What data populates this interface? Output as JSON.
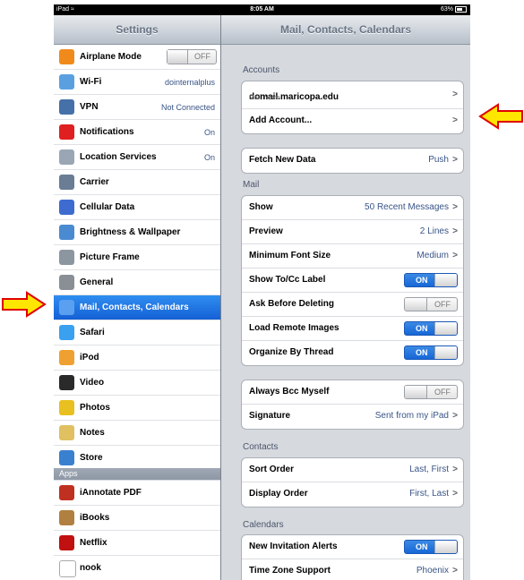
{
  "statusbar": {
    "device": "iPad",
    "time": "8:05 AM",
    "battery": "63%"
  },
  "left": {
    "title": "Settings",
    "items": [
      {
        "label": "Airplane Mode",
        "toggle": "OFF",
        "icon": "airplane-icon",
        "color": "#f08a1a"
      },
      {
        "label": "Wi-Fi",
        "value": "dointernalplus",
        "icon": "wifi-icon",
        "color": "#5aa0e0"
      },
      {
        "label": "VPN",
        "value": "Not Connected",
        "icon": "vpn-icon",
        "color": "#4670a8"
      },
      {
        "label": "Notifications",
        "value": "On",
        "icon": "notifications-icon",
        "color": "#e02020"
      },
      {
        "label": "Location Services",
        "value": "On",
        "icon": "location-icon",
        "color": "#9aa6b4"
      },
      {
        "label": "Carrier",
        "icon": "carrier-icon",
        "color": "#6a7d95"
      },
      {
        "label": "Cellular Data",
        "icon": "cellular-icon",
        "color": "#3d6bd0"
      },
      {
        "label": "Brightness & Wallpaper",
        "icon": "brightness-icon",
        "color": "#4a8ad0"
      },
      {
        "label": "Picture Frame",
        "icon": "picture-frame-icon",
        "color": "#8c96a0"
      },
      {
        "label": "General",
        "icon": "gear-icon",
        "color": "#8a8f96"
      },
      {
        "label": "Mail, Contacts, Calendars",
        "icon": "mail-icon",
        "color": "#5aa0f0",
        "selected": true
      },
      {
        "label": "Safari",
        "icon": "safari-icon",
        "color": "#3aa0f0"
      },
      {
        "label": "iPod",
        "icon": "ipod-icon",
        "color": "#f0a030"
      },
      {
        "label": "Video",
        "icon": "video-icon",
        "color": "#2a2a2a"
      },
      {
        "label": "Photos",
        "icon": "photos-icon",
        "color": "#e8c020"
      },
      {
        "label": "Notes",
        "icon": "notes-icon",
        "color": "#e0c060"
      },
      {
        "label": "Store",
        "icon": "store-icon",
        "color": "#3a80d0"
      }
    ],
    "apps_header": "Apps",
    "apps": [
      {
        "label": "iAnnotate PDF",
        "icon": "iannotate-icon",
        "color": "#c03020"
      },
      {
        "label": "iBooks",
        "icon": "ibooks-icon",
        "color": "#b08040"
      },
      {
        "label": "Netflix",
        "icon": "netflix-icon",
        "color": "#c01010"
      },
      {
        "label": "nook",
        "icon": "nook-icon",
        "color": "#ffffff"
      }
    ]
  },
  "right": {
    "title": "Mail, Contacts, Calendars",
    "accounts_header": "Accounts",
    "accounts": [
      {
        "label": "domail.maricopa.edu",
        "sub": "Mail, Notes"
      },
      {
        "label": "Add Account..."
      }
    ],
    "fetch": {
      "label": "Fetch New Data",
      "value": "Push"
    },
    "mail_header": "Mail",
    "mail": [
      {
        "label": "Show",
        "value": "50 Recent Messages"
      },
      {
        "label": "Preview",
        "value": "2 Lines"
      },
      {
        "label": "Minimum Font Size",
        "value": "Medium"
      },
      {
        "label": "Show To/Cc Label",
        "toggle": "ON"
      },
      {
        "label": "Ask Before Deleting",
        "toggle": "OFF"
      },
      {
        "label": "Load Remote Images",
        "toggle": "ON"
      },
      {
        "label": "Organize By Thread",
        "toggle": "ON"
      }
    ],
    "mail2": [
      {
        "label": "Always Bcc Myself",
        "toggle": "OFF"
      },
      {
        "label": "Signature",
        "value": "Sent from my iPad"
      }
    ],
    "contacts_header": "Contacts",
    "contacts": [
      {
        "label": "Sort Order",
        "value": "Last, First"
      },
      {
        "label": "Display Order",
        "value": "First, Last"
      }
    ],
    "calendars_header": "Calendars",
    "calendars": [
      {
        "label": "New Invitation Alerts",
        "toggle": "ON"
      },
      {
        "label": "Time Zone Support",
        "value": "Phoenix"
      }
    ]
  },
  "chevron": ">",
  "colors": {
    "selection": "#1f74e4",
    "value_text": "#385487",
    "arrow_fill": "#ffe600",
    "arrow_stroke": "#e00000"
  }
}
